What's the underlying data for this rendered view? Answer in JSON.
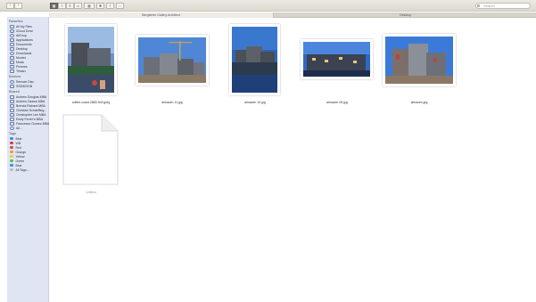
{
  "toolbar": {
    "nav_back": "‹",
    "nav_forward": "›",
    "view_modes": [
      "icon",
      "list",
      "column",
      "cover-flow"
    ],
    "arrange_label": "▦",
    "action_label": "✱",
    "share_label": "⇪",
    "tag_label": "○",
    "search_placeholder": "Search"
  },
  "tabs": [
    {
      "label": "Bergström Gallery Architect"
    },
    {
      "label": "Desktop"
    }
  ],
  "sidebar": {
    "favorites_header": "Favorites",
    "favorites": [
      {
        "label": "All My Files",
        "icon": "all-files-icon"
      },
      {
        "label": "iCloud Drive",
        "icon": "cloud-icon"
      },
      {
        "label": "AirDrop",
        "icon": "airdrop-icon"
      },
      {
        "label": "Applications",
        "icon": "applications-icon"
      },
      {
        "label": "Documents",
        "icon": "documents-icon"
      },
      {
        "label": "Desktop",
        "icon": "desktop-icon"
      },
      {
        "label": "Downloads",
        "icon": "downloads-icon"
      },
      {
        "label": "Movies",
        "icon": "movies-icon"
      },
      {
        "label": "Music",
        "icon": "music-icon"
      },
      {
        "label": "Pictures",
        "icon": "pictures-icon"
      },
      {
        "label": "Tristan",
        "icon": "home-icon"
      }
    ],
    "devices_header": "Devices",
    "devices": [
      {
        "label": "Remote Disc",
        "icon": "disc-icon"
      },
      {
        "label": "SSD500GB",
        "icon": "drive-icon"
      }
    ],
    "shared_header": "Shared",
    "shared": [
      {
        "label": "Andrew Douglas MBA",
        "icon": "computer-icon"
      },
      {
        "label": "Andrew Ozawa MBA",
        "icon": "computer-icon"
      },
      {
        "label": "Brenda Richard MBA",
        "icon": "computer-icon"
      },
      {
        "label": "Christian Schaeffing...",
        "icon": "computer-icon"
      },
      {
        "label": "Christopher Lee MBA",
        "icon": "computer-icon"
      },
      {
        "label": "Emily Ferrer's MBA",
        "icon": "computer-icon"
      },
      {
        "label": "Francesco Gomez MBA",
        "icon": "computer-icon"
      },
      {
        "label": "All...",
        "icon": "network-icon"
      }
    ],
    "tags_header": "Tags",
    "tags": [
      {
        "label": "Blue",
        "color": "#3f86e6"
      },
      {
        "label": "Will",
        "color": "#d23f3f"
      },
      {
        "label": "Red",
        "color": "#e8413c"
      },
      {
        "label": "Orange",
        "color": "#f29a33"
      },
      {
        "label": "Yellow",
        "color": "#efcd30"
      },
      {
        "label": "Green",
        "color": "#57c043"
      },
      {
        "label": "Blue",
        "color": "#3f86e6"
      },
      {
        "label": "All Tags...",
        "color": "#b9bcc4"
      }
    ]
  },
  "files": [
    {
      "name": "coffee-coast-2880-540.jpeg",
      "icon": "photo-thumbnail-icon"
    },
    {
      "name": "almazen 11.jpg",
      "icon": "photo-thumbnail-icon"
    },
    {
      "name": "almazen 10.jpg",
      "icon": "photo-thumbnail-icon"
    },
    {
      "name": "almazen 09.jpg",
      "icon": "photo-thumbnail-icon"
    },
    {
      "name": "almazen.jpg",
      "icon": "photo-thumbnail-icon"
    },
    {
      "name": "Untitled",
      "icon": "blank-document-icon"
    }
  ]
}
